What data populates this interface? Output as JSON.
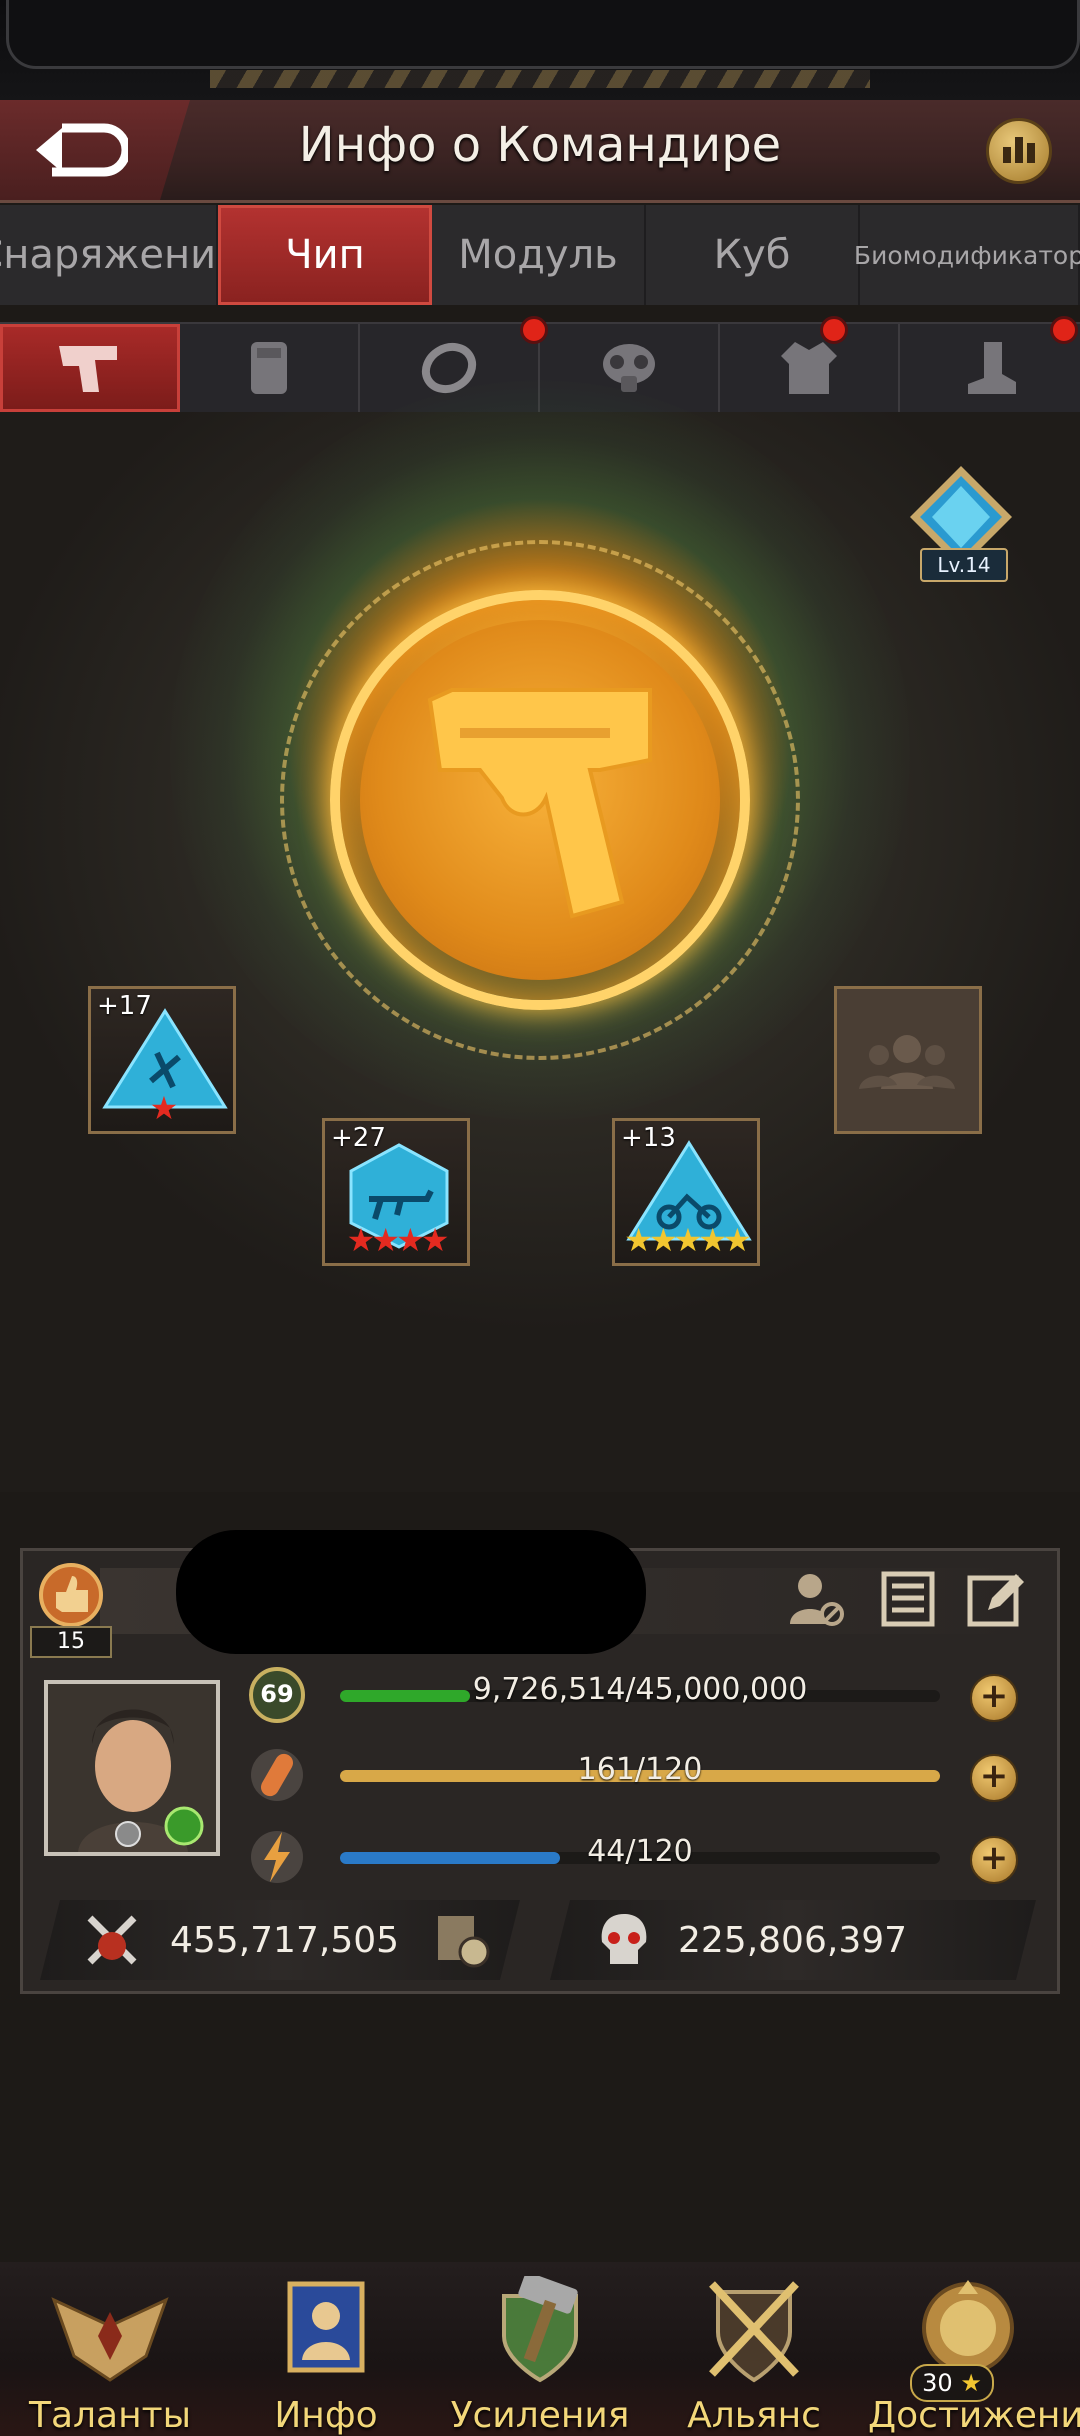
{
  "header": {
    "title": "Инфо о Командире"
  },
  "tabs": [
    {
      "label": "Снаряжение",
      "active": false
    },
    {
      "label": "Чип",
      "active": true
    },
    {
      "label": "Модуль",
      "active": false
    },
    {
      "label": "Куб",
      "active": false
    },
    {
      "label": "Биомодификатор",
      "active": false
    }
  ],
  "slots": [
    {
      "icon": "pistol-icon",
      "active": true,
      "alert": false
    },
    {
      "icon": "vest-icon",
      "active": false,
      "alert": false
    },
    {
      "icon": "ring-icon",
      "active": false,
      "alert": true
    },
    {
      "icon": "gas-mask-icon",
      "active": false,
      "alert": false
    },
    {
      "icon": "jacket-icon",
      "active": false,
      "alert": true
    },
    {
      "icon": "boot-icon",
      "active": false,
      "alert": true
    }
  ],
  "core": {
    "level_label": "Lv.14"
  },
  "chips": [
    {
      "plus": "+17",
      "stars": 1
    },
    {
      "plus": "+27",
      "stars": 4
    },
    {
      "plus": "+13",
      "stars": 5
    }
  ],
  "commander": {
    "power_level": "15",
    "level": "69",
    "exp": "9,726,514/45,000,000",
    "exp_fraction": 0.216,
    "stamina": "161/120",
    "stamina_fraction": 1.0,
    "energy": "44/120",
    "energy_fraction": 0.367,
    "power": "455,717,505",
    "kills": "225,806,397"
  },
  "nav": [
    {
      "label": "Таланты"
    },
    {
      "label": "Инфо"
    },
    {
      "label": "Усиления"
    },
    {
      "label": "Альянс"
    },
    {
      "label": "Достижение",
      "badge": "30"
    }
  ],
  "colors": {
    "accent_red": "#b33230",
    "exp_bar": "#2fa82a",
    "stamina_bar": "#d8a848",
    "energy_bar": "#2a7ac8",
    "gold": "#f3d77a"
  }
}
